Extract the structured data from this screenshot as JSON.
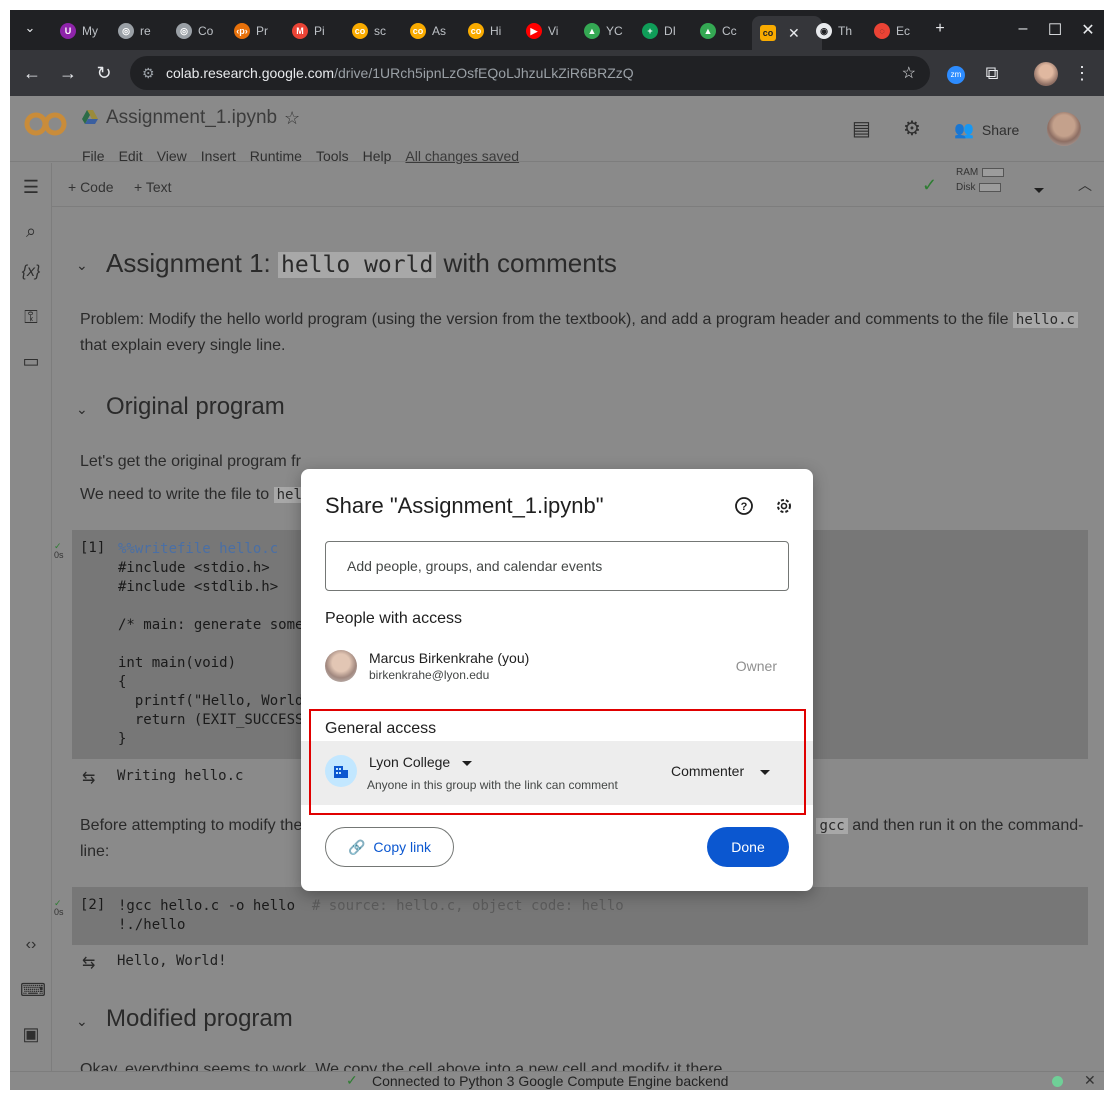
{
  "browser": {
    "tabs": [
      {
        "label": "My",
        "color": "#8e24aa",
        "glyph": "U"
      },
      {
        "label": "re",
        "color": "#9aa0a6",
        "glyph": "◎"
      },
      {
        "label": "Co",
        "color": "#9aa0a6",
        "glyph": "◎"
      },
      {
        "label": "Pr",
        "color": "#e8710a",
        "glyph": "‹p›"
      },
      {
        "label": "Pi",
        "color": "#ea4335",
        "glyph": "M"
      },
      {
        "label": "sc",
        "color": "#f9ab00",
        "glyph": "co"
      },
      {
        "label": "As",
        "color": "#f9ab00",
        "glyph": "co"
      },
      {
        "label": "Hi",
        "color": "#f9ab00",
        "glyph": "co"
      },
      {
        "label": "Vi",
        "color": "#ff0000",
        "glyph": "▶"
      },
      {
        "label": "YC",
        "color": "#34a853",
        "glyph": "▲"
      },
      {
        "label": "DI",
        "color": "#0f9d58",
        "glyph": "+"
      },
      {
        "label": "Cc",
        "color": "#34a853",
        "glyph": "▲"
      }
    ],
    "active_tab": {
      "glyph": "co",
      "color": "#f9ab00"
    },
    "tabs_after": [
      {
        "label": "Th",
        "color": "#e8eaed",
        "glyph": "◉"
      },
      {
        "label": "Ec",
        "color": "#ea4335",
        "glyph": "◌"
      }
    ],
    "new_tab": "+",
    "url_host": "colab.research.google.com",
    "url_path": "/drive/1URch5ipnLzOsfEQoLJhzuLkZiR6BRZzQ",
    "ext_badge": "zm"
  },
  "header": {
    "logo": "CO",
    "title": "Assignment_1.ipynb",
    "menu": [
      "File",
      "Edit",
      "View",
      "Insert",
      "Runtime",
      "Tools",
      "Help"
    ],
    "saved_status": "All changes saved",
    "share_label": "Share"
  },
  "toolbar": {
    "add_code": "+ Code",
    "add_text": "+ Text",
    "ram_label": "RAM",
    "disk_label": "Disk"
  },
  "notebook": {
    "h1_prefix": "Assignment 1: ",
    "h1_code": "hello world",
    "h1_suffix": " with comments",
    "problem_text": "Problem: Modify the hello world program (using the version from the textbook), and add a program header and comments to the file ",
    "problem_code": "hello.c",
    "problem_tail": " that explain every single line.",
    "h2_original": "Original program",
    "orig_p1": "Let's get the original program fr",
    "orig_p2": "We need to write the file to ",
    "orig_p2_code": "hel",
    "cell1_num": "[1]",
    "cell1_time": "0s",
    "cell1_magic": "%%writefile hello.c",
    "cell1_lines": [
      "#include <stdio.h>",
      "#include <stdlib.h>",
      "",
      "/* main: generate some",
      "",
      "int main(void)",
      "{",
      "  printf(\"Hello, World",
      "  return (EXIT_SUCCESS",
      "}"
    ],
    "cell1_output": "Writing hello.c",
    "before_text": "Before attempting to modify the file with a header and comments, let's test it: We need to compile it with ",
    "before_code": "gcc",
    "before_tail": " and then run it on the command-line:",
    "cell2_num": "[2]",
    "cell2_time": "0s",
    "cell2_line1": "!gcc hello.c -o hello",
    "cell2_comment": "# source: hello.c, object code: hello",
    "cell2_line2": "!./hello",
    "cell2_output": "Hello, World!",
    "h2_modified": "Modified program",
    "modified_p": "Okay, everything seems to work. We copy the cell above into a new cell and modify it there."
  },
  "status": {
    "text": "Connected to Python 3 Google Compute Engine backend"
  },
  "share_dialog": {
    "title": "Share \"Assignment_1.ipynb\"",
    "add_placeholder": "Add people, groups, and calendar events",
    "people_heading": "People with access",
    "person_name": "Marcus Birkenkrahe (you)",
    "person_email": "birkenkrahe@lyon.edu",
    "person_role": "Owner",
    "general_heading": "General access",
    "org_name": "Lyon College",
    "org_desc": "Anyone in this group with the link can comment",
    "org_role": "Commenter",
    "copy_link": "Copy link",
    "done": "Done"
  },
  "colors": {
    "accent": "#0b57d0",
    "highlight_box": "#e00000",
    "dim_overlay": "#8a8a8a"
  }
}
